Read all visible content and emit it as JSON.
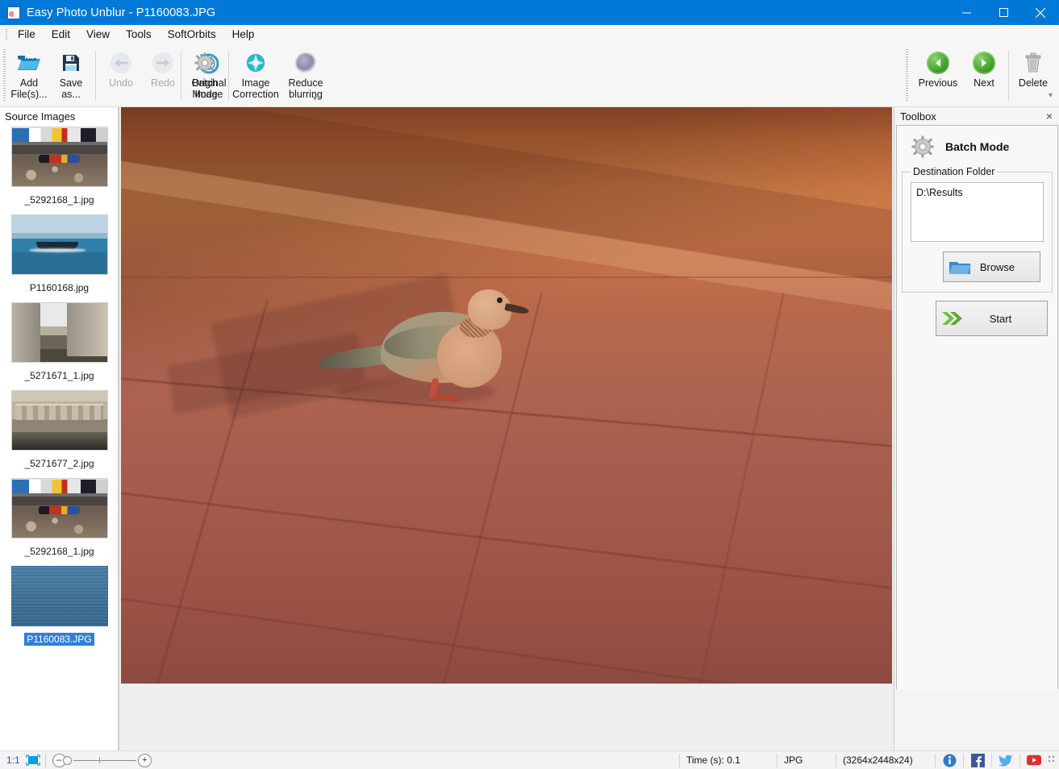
{
  "window": {
    "title": "Easy Photo Unblur - P1160083.JPG",
    "app_icon": "photo-app-icon",
    "minimize_label": "Minimize",
    "maximize_label": "Maximize",
    "close_label": "Close",
    "accent_color": "#0078d7"
  },
  "menubar": {
    "items": [
      {
        "label": "File"
      },
      {
        "label": "Edit"
      },
      {
        "label": "View"
      },
      {
        "label": "Tools"
      },
      {
        "label": "SoftOrbits"
      },
      {
        "label": "Help"
      }
    ]
  },
  "toolbar": {
    "overflow_label": "▾",
    "left_buttons": [
      {
        "label": "Add\nFile(s)...",
        "icon": "add-files-icon",
        "disabled": false
      },
      {
        "label": "Save\nas...",
        "icon": "save-as-icon",
        "disabled": false
      },
      {
        "label": "Undo",
        "icon": "undo-icon",
        "disabled": true
      },
      {
        "label": "Redo",
        "icon": "redo-icon",
        "disabled": true
      },
      {
        "label": "Original\nImage",
        "icon": "original-image-icon",
        "disabled": false
      },
      {
        "label": "Batch\nMode",
        "icon": "batch-mode-icon",
        "disabled": false
      },
      {
        "label": "Image\nCorrection",
        "icon": "image-correction-icon",
        "disabled": false
      },
      {
        "label": "Reduce\nblurring",
        "icon": "reduce-blurring-icon",
        "disabled": false
      }
    ],
    "right_buttons": [
      {
        "label": "Previous",
        "icon": "previous-icon"
      },
      {
        "label": "Next",
        "icon": "next-icon"
      },
      {
        "label": "Delete",
        "icon": "delete-icon"
      }
    ]
  },
  "source_images": {
    "header": "Source Images",
    "items": [
      {
        "name": "_5292168_1.jpg",
        "scene": "race",
        "selected": false
      },
      {
        "name": "P1160168.jpg",
        "scene": "sea",
        "selected": false
      },
      {
        "name": "_5271671_1.jpg",
        "scene": "street",
        "selected": false
      },
      {
        "name": "_5271677_2.jpg",
        "scene": "arch",
        "selected": false
      },
      {
        "name": "_5292168_1.jpg",
        "scene": "race",
        "selected": false
      },
      {
        "name": "P1160083.JPG",
        "scene": "bluewater",
        "selected": true
      }
    ]
  },
  "toolbox": {
    "header": "Toolbox",
    "close_label": "×",
    "panel_title": "Batch Mode",
    "panel_icon": "gear-icon",
    "destination_group_label": "Destination Folder",
    "destination_value": "D:\\Results",
    "browse_label": "Browse",
    "browse_icon": "folder-icon",
    "start_label": "Start",
    "start_icon": "green-arrow-icon"
  },
  "statusbar": {
    "zoom_ratio": "1:1",
    "fit_icon": "fit-to-window-icon",
    "zoom_out_label": "–",
    "zoom_in_label": "+",
    "time_label": "Time (s): 0.1",
    "format_label": "JPG",
    "dimensions_label": "(3264x2448x24)",
    "social": [
      {
        "name": "info-icon",
        "color": "#2e7cc4"
      },
      {
        "name": "facebook-icon",
        "color": "#3b5998"
      },
      {
        "name": "twitter-icon",
        "color": "#55acee"
      },
      {
        "name": "youtube-icon",
        "color": "#e02f2f"
      }
    ]
  },
  "canvas": {
    "photo_alt": "dove-on-red-stone-pavement"
  }
}
